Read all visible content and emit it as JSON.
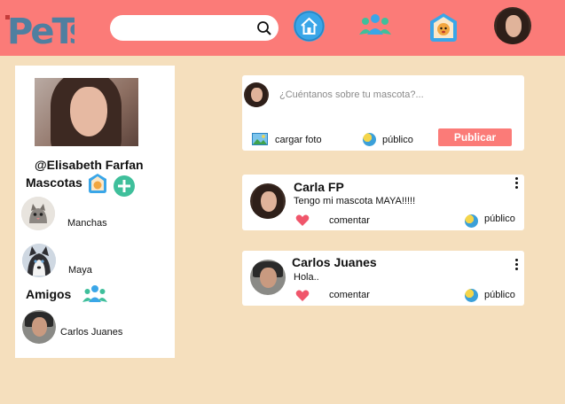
{
  "header": {
    "logo_text": "PeTs",
    "search": {
      "placeholder": "",
      "value": ""
    },
    "nav": [
      "home-icon",
      "friends-icon",
      "pets-icon",
      "profile-avatar"
    ]
  },
  "profile": {
    "username": "@Elisabeth Farfan",
    "pets_title": "Mascotas",
    "pets": [
      {
        "name": "Manchas"
      },
      {
        "name": "Maya"
      }
    ],
    "friends_title": "Amigos",
    "friends": [
      {
        "name": "Carlos Juanes"
      }
    ]
  },
  "composer": {
    "placeholder": "¿Cuéntanos sobre tu mascota?...",
    "upload_label": "cargar foto",
    "visibility_label": "público",
    "publish_label": "Publicar"
  },
  "posts": [
    {
      "author": "Carla FP",
      "text": "Tengo mi mascota MAYA!!!!!",
      "comment_label": "comentar",
      "visibility_label": "público"
    },
    {
      "author": "Carlos Juanes",
      "text": "Hola..",
      "comment_label": "comentar",
      "visibility_label": "público"
    }
  ],
  "colors": {
    "header": "#fb7b78",
    "background": "#f5dfbd",
    "accent": "#fb7b78",
    "logo": "#4f7fa0"
  }
}
